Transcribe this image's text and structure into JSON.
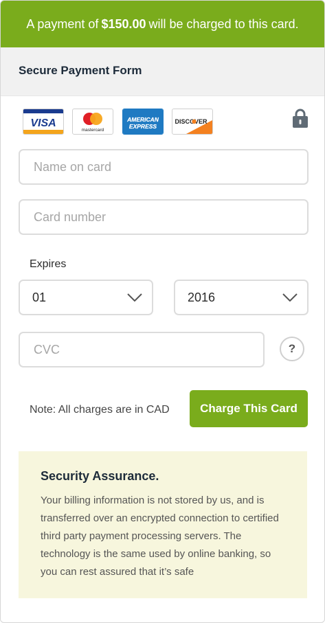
{
  "banner": {
    "prefix": "A payment of",
    "amount": "$150.00",
    "suffix": "will be charged to this card."
  },
  "header": {
    "title": "Secure Payment Form",
    "icon": "lock-icon"
  },
  "card_logos": [
    {
      "brand": "VISA",
      "icon": "visa-logo"
    },
    {
      "brand": "mastercard",
      "icon": "mastercard-logo"
    },
    {
      "brand": "AMERICAN EXPRESS",
      "icon": "amex-logo"
    },
    {
      "brand": "DISCOVER",
      "icon": "discover-logo"
    }
  ],
  "form": {
    "name_placeholder": "Name on card",
    "name_value": "",
    "number_placeholder": "Card number",
    "number_value": "",
    "expires_label": "Expires",
    "month_value": "01",
    "year_value": "2016",
    "cvc_placeholder": "CVC",
    "cvc_value": "",
    "help_label": "?"
  },
  "footer": {
    "note": "Note: All charges are in CAD",
    "charge_label": "Charge This Card"
  },
  "assurance": {
    "title": "Security Assurance.",
    "body": "Your billing information is not stored by us, and is transferred over an encrypted connection to certified third party payment processing servers. The technology is the same used by online banking, so you can rest assured that it’s safe"
  },
  "colors": {
    "accent": "#7aac1c",
    "assurance_bg": "#f7f6dd",
    "header_bg": "#f1f1f1"
  }
}
